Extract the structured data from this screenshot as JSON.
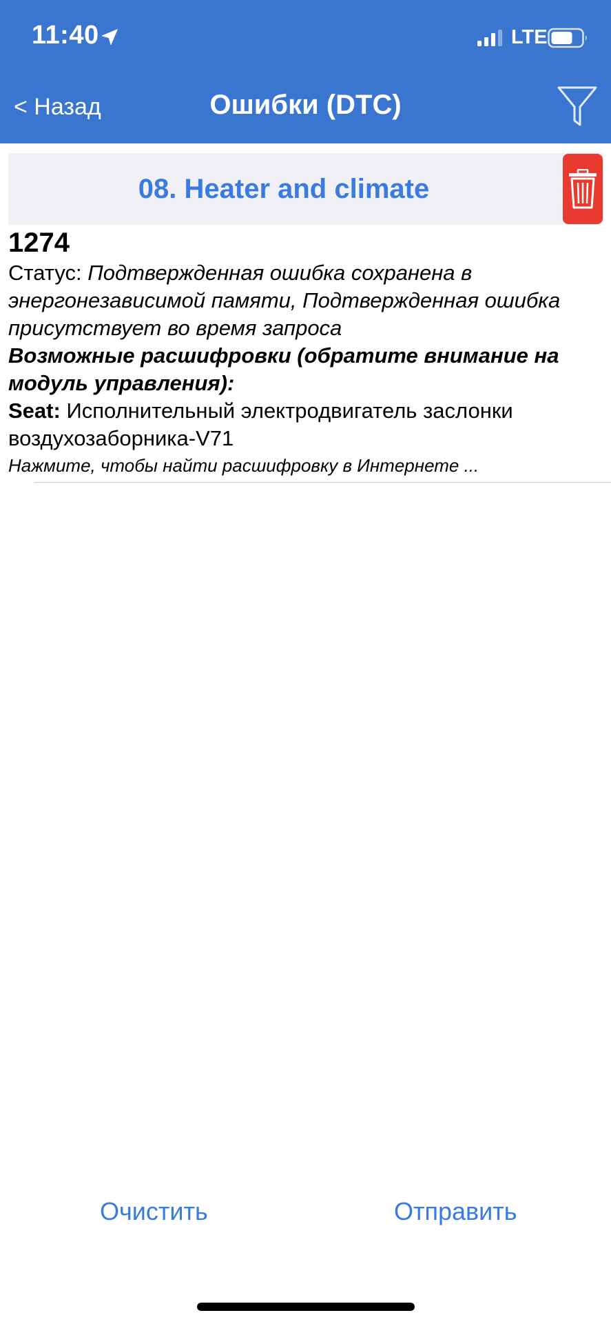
{
  "status_bar": {
    "time": "11:40",
    "network": "LTE"
  },
  "nav": {
    "back_label": "< Назад",
    "title": "Ошибки (DTC)"
  },
  "module": {
    "title": "08. Heater and climate"
  },
  "error": {
    "code": "1274",
    "status_label": "Статус:",
    "status_value": "Подтвержденная ошибка сохранена в энергонезависимой памяти, Подтвержденная ошибка присутствует во время запроса",
    "decode_heading": "Возможные расшифровки (обратите внимание на модуль управления):",
    "decode_brand": "Seat:",
    "decode_text": "Исполнительный электродвигатель заслонки воздухозаборника-V71",
    "search_hint": "Нажмите, чтобы найти расшифровку в Интернете ..."
  },
  "toolbar": {
    "clear_label": "Очистить",
    "send_label": "Отправить"
  },
  "colors": {
    "nav_background": "#3a75cf",
    "accent": "#3a7be0",
    "delete": "#e83a2e",
    "module_background": "#f0f0f5"
  }
}
